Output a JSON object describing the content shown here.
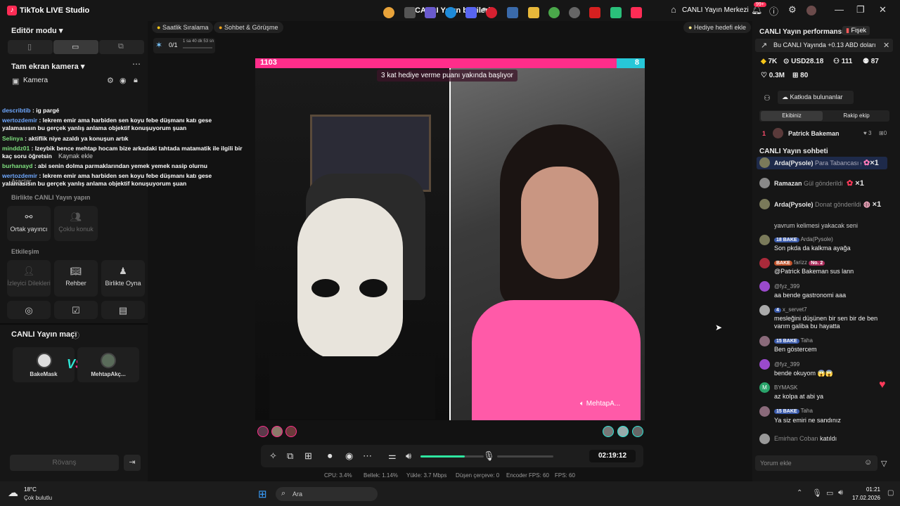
{
  "app": {
    "title": "TikTok LIVE Studio",
    "center_title": "CANLI Yayın bilgileri",
    "live_center": "CANLI Yayın Merkezi",
    "notif_count": "99+"
  },
  "left": {
    "mode_label": "Editör modu",
    "camera_section": "Tam ekran kamera",
    "camera_item": "Kamera",
    "kaynak_ekle": "Kaynak ekle",
    "araclar": "Araçlar",
    "collab_title": "Birlikte CANLI Yayın yapın",
    "collab_items": [
      "Ortak yayıncı",
      "Çoklu konuk"
    ],
    "interaction_title": "Etkileşim",
    "interaction_items": [
      "İzleyici Dilekleri",
      "Rehber",
      "Birlikte Oyna"
    ],
    "match_title": "CANLI Yayın maçı",
    "match_players": [
      "BakeMask",
      "MehtapAkç..."
    ],
    "rematch": "Rövanş"
  },
  "overlay_chat": [
    {
      "user": "describtib",
      "text": "ig pargé"
    },
    {
      "user": "wertozdemir",
      "text": "lekrem emir ama harbiden sen koyu febe düşmanı katı gese yalamasısın bu gerçek yanlış anlama objektif konuşuyorum şuan"
    },
    {
      "user": "Selinya",
      "text": "aktiflik niye azaldı ya konuşun artık"
    },
    {
      "user": "minddz01",
      "text": "Izeybik bence mehtap hocam bize arkadaki tahtada matamatik ile ilgili bir kaç soru öğretsin"
    },
    {
      "user": "burhanayd",
      "text": "abi senin dolma parmaklarından yemek yemek nasip olurnu"
    },
    {
      "user": "wertozdemir",
      "text": "lekrem emir ama harbiden sen koyu febe düşmanı katı gese yalamasısın bu gerçek yanlış anlama objektif konuşuyorum şuan"
    }
  ],
  "top_buttons": {
    "hourly": "Saatlik Sıralama",
    "chat": "Sohbet & Görüşme",
    "gift_goal": "Hediye hedefi ekle"
  },
  "goal": {
    "count": "0/1",
    "time": "1 sa 40 dk 53 sn"
  },
  "battle": {
    "left_score": "1103",
    "right_score": "8",
    "banner": "3 kat hediye verme puanı yakında başlıyor",
    "right_name": "MehtapA..."
  },
  "controls": {
    "timer": "02:19:12",
    "volume_pct": 70
  },
  "stats": {
    "cpu": "CPU: 3.4%",
    "memory": "Bellek: 1.14%",
    "upload": "Yükle: 3.7 Mbps",
    "dropped": "Düşen çerçeve: 0",
    "encoder": "Encoder FPS: 60",
    "fps": "FPS: 60"
  },
  "right": {
    "perf_title": "CANLI Yayın performansı",
    "perf_tag": "Fişek",
    "notice": "Bu CANLI Yayında +0.13 ABD doları",
    "metrics": [
      "7K",
      "USD28.18",
      "111",
      "87"
    ],
    "metrics2": [
      "0.3M",
      "80"
    ],
    "contrib": "Katkıda bulunanlar",
    "tabs": [
      "Ekibiniz",
      "Rakip ekip"
    ],
    "top_contrib": {
      "rank": "1",
      "name": "Patrick Bakeman",
      "likes": "3",
      "gifts": "0"
    },
    "chat_title": "CANLI Yayın sohbeti",
    "gifts": [
      {
        "user": "Arda(Pysole)",
        "gift": "Para Tabancası g",
        "count": "×1"
      },
      {
        "user": "Ramazan",
        "gift": "Gül gönderildi",
        "count": "×1"
      },
      {
        "user": "Arda(Pysole)",
        "gift": "Donat gönderildi",
        "count": "×1"
      }
    ],
    "partial_msg": "yavrum kelimesi yakacak seni",
    "messages": [
      {
        "badges": "18 BAKE",
        "user": "Arda(Pysole)",
        "text": "Son pkda da kalkma ayağa"
      },
      {
        "badges": "BAKE",
        "user": "farizz",
        "extra": "No. 2",
        "text": "@Patrick Bakeman sus lann"
      },
      {
        "badges": "",
        "user": "@fyz_399",
        "text": "aa bende gastronomi aaa"
      },
      {
        "badges": "4",
        "user": "x_servet7",
        "text": "mesleğini düşünen bir sen bir de ben varım galiba bu hayatta"
      },
      {
        "badges": "15 BAKE",
        "user": "Taha",
        "text": "Ben göstercem"
      },
      {
        "badges": "",
        "user": "@fyz_399",
        "text": "bende okuyom 😱😱"
      },
      {
        "badges": "",
        "user": "BYMASK",
        "text": "az kolpa at abi ya"
      },
      {
        "badges": "15 BAKE",
        "user": "Taha",
        "text": "Ya siz emiri ne sandınız"
      }
    ],
    "join": {
      "user": "Emirhan Coban",
      "text": "katıldı"
    },
    "comment_placeholder": "Yorum ekle"
  },
  "taskbar": {
    "weather_temp": "18°C",
    "weather_text": "Çok bulutlu",
    "search": "Ara",
    "time": "01:21",
    "date": "17.02.2026"
  }
}
